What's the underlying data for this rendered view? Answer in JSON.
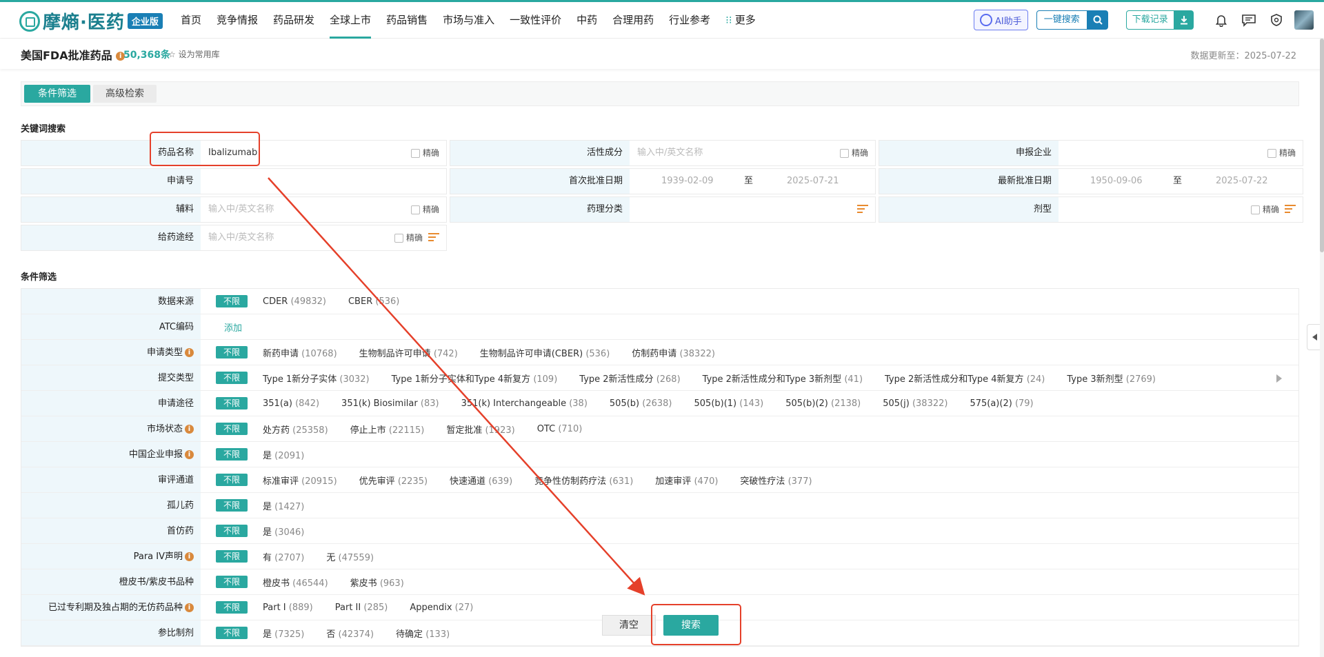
{
  "nav": {
    "logo": "摩熵·医药",
    "edition": "企业版",
    "menu": [
      "首页",
      "竞争情报",
      "药品研发",
      "全球上市",
      "药品销售",
      "市场与准入",
      "一致性评价",
      "中药",
      "合理用药",
      "行业参考",
      "更多"
    ],
    "ai_label": "AI助手",
    "search_label": "一键搜索",
    "download_label": "下载记录"
  },
  "header": {
    "title": "美国FDA批准药品",
    "total": "50,368条",
    "favorite": "设为常用库",
    "updated": "数据更新至：2025-07-22"
  },
  "tabs": {
    "filter": "条件筛选",
    "advanced": "高级检索"
  },
  "keyword": {
    "section": "关键词搜索",
    "exact": "精确",
    "to": "至",
    "drug_name_label": "药品名称",
    "drug_name_value": "Ibalizumab",
    "active_label": "活性成分",
    "active_placeholder": "输入中/英文名称",
    "company_label": "申报企业",
    "appno_label": "申请号",
    "first_date_label": "首次批准日期",
    "first_date_from": "1939-02-09",
    "first_date_to": "2025-07-21",
    "latest_date_label": "最新批准日期",
    "latest_date_from": "1950-09-06",
    "latest_date_to": "2025-07-22",
    "excipient_label": "辅料",
    "excipient_placeholder": "输入中/英文名称",
    "pharm_label": "药理分类",
    "dosage_label": "剂型",
    "route_label": "给药途经",
    "route_placeholder": "输入中/英文名称"
  },
  "conditions": {
    "section": "条件筛选",
    "unlimited": "不限",
    "add": "添加",
    "rows": [
      {
        "label": "数据来源",
        "info": false,
        "options": [
          [
            "CDER",
            "(49832)"
          ],
          [
            "CBER",
            "(536)"
          ]
        ]
      },
      {
        "label": "ATC编码",
        "info": false,
        "options": []
      },
      {
        "label": "申请类型",
        "info": true,
        "options": [
          [
            "新药申请",
            "(10768)"
          ],
          [
            "生物制品许可申请",
            "(742)"
          ],
          [
            "生物制品许可申请(CBER)",
            "(536)"
          ],
          [
            "仿制药申请",
            "(38322)"
          ]
        ]
      },
      {
        "label": "提交类型",
        "info": false,
        "options": [
          [
            "Type 1新分子实体",
            "(3032)"
          ],
          [
            "Type 1新分子实体和Type 4新复方",
            "(109)"
          ],
          [
            "Type 2新活性成分",
            "(268)"
          ],
          [
            "Type 2新活性成分和Type 3新剂型",
            "(41)"
          ],
          [
            "Type 2新活性成分和Type 4新复方",
            "(24)"
          ],
          [
            "Type 3新剂型",
            "(2769)"
          ]
        ]
      },
      {
        "label": "申请途径",
        "info": false,
        "options": [
          [
            "351(a)",
            "(842)"
          ],
          [
            "351(k) Biosimilar",
            "(83)"
          ],
          [
            "351(k) Interchangeable",
            "(38)"
          ],
          [
            "505(b)",
            "(2638)"
          ],
          [
            "505(b)(1)",
            "(143)"
          ],
          [
            "505(b)(2)",
            "(2138)"
          ],
          [
            "505(j)",
            "(38322)"
          ],
          [
            "575(a)(2)",
            "(79)"
          ]
        ]
      },
      {
        "label": "市场状态",
        "info": true,
        "options": [
          [
            "处方药",
            "(25358)"
          ],
          [
            "停止上市",
            "(22115)"
          ],
          [
            "暂定批准",
            "(1923)"
          ],
          [
            "OTC",
            "(710)"
          ]
        ]
      },
      {
        "label": "中国企业申报",
        "info": true,
        "options": [
          [
            "是",
            "(2091)"
          ]
        ]
      },
      {
        "label": "审评通道",
        "info": false,
        "options": [
          [
            "标准审评",
            "(20915)"
          ],
          [
            "优先审评",
            "(2235)"
          ],
          [
            "快速通道",
            "(639)"
          ],
          [
            "竞争性仿制药疗法",
            "(631)"
          ],
          [
            "加速审评",
            "(470)"
          ],
          [
            "突破性疗法",
            "(377)"
          ]
        ]
      },
      {
        "label": "孤儿药",
        "info": false,
        "options": [
          [
            "是",
            "(1427)"
          ]
        ]
      },
      {
        "label": "首仿药",
        "info": false,
        "options": [
          [
            "是",
            "(3046)"
          ]
        ]
      },
      {
        "label": "Para IV声明",
        "info": true,
        "options": [
          [
            "有",
            "(2707)"
          ],
          [
            "无",
            "(47559)"
          ]
        ]
      },
      {
        "label": "橙皮书/紫皮书品种",
        "info": false,
        "options": [
          [
            "橙皮书",
            "(46544)"
          ],
          [
            "紫皮书",
            "(963)"
          ]
        ]
      },
      {
        "label": "已过专利期及独占期的无仿药品种",
        "info": true,
        "options": [
          [
            "Part I",
            "(889)"
          ],
          [
            "Part II",
            "(285)"
          ],
          [
            "Appendix",
            "(27)"
          ]
        ]
      },
      {
        "label": "参比制剂",
        "info": false,
        "options": [
          [
            "是",
            "(7325)"
          ],
          [
            "否",
            "(42374)"
          ],
          [
            "待确定",
            "(133)"
          ]
        ]
      }
    ]
  },
  "actions": {
    "clear": "清空",
    "search": "搜索"
  },
  "colors": {
    "accent": "#2aa8a0",
    "annotation": "#e5402a"
  }
}
